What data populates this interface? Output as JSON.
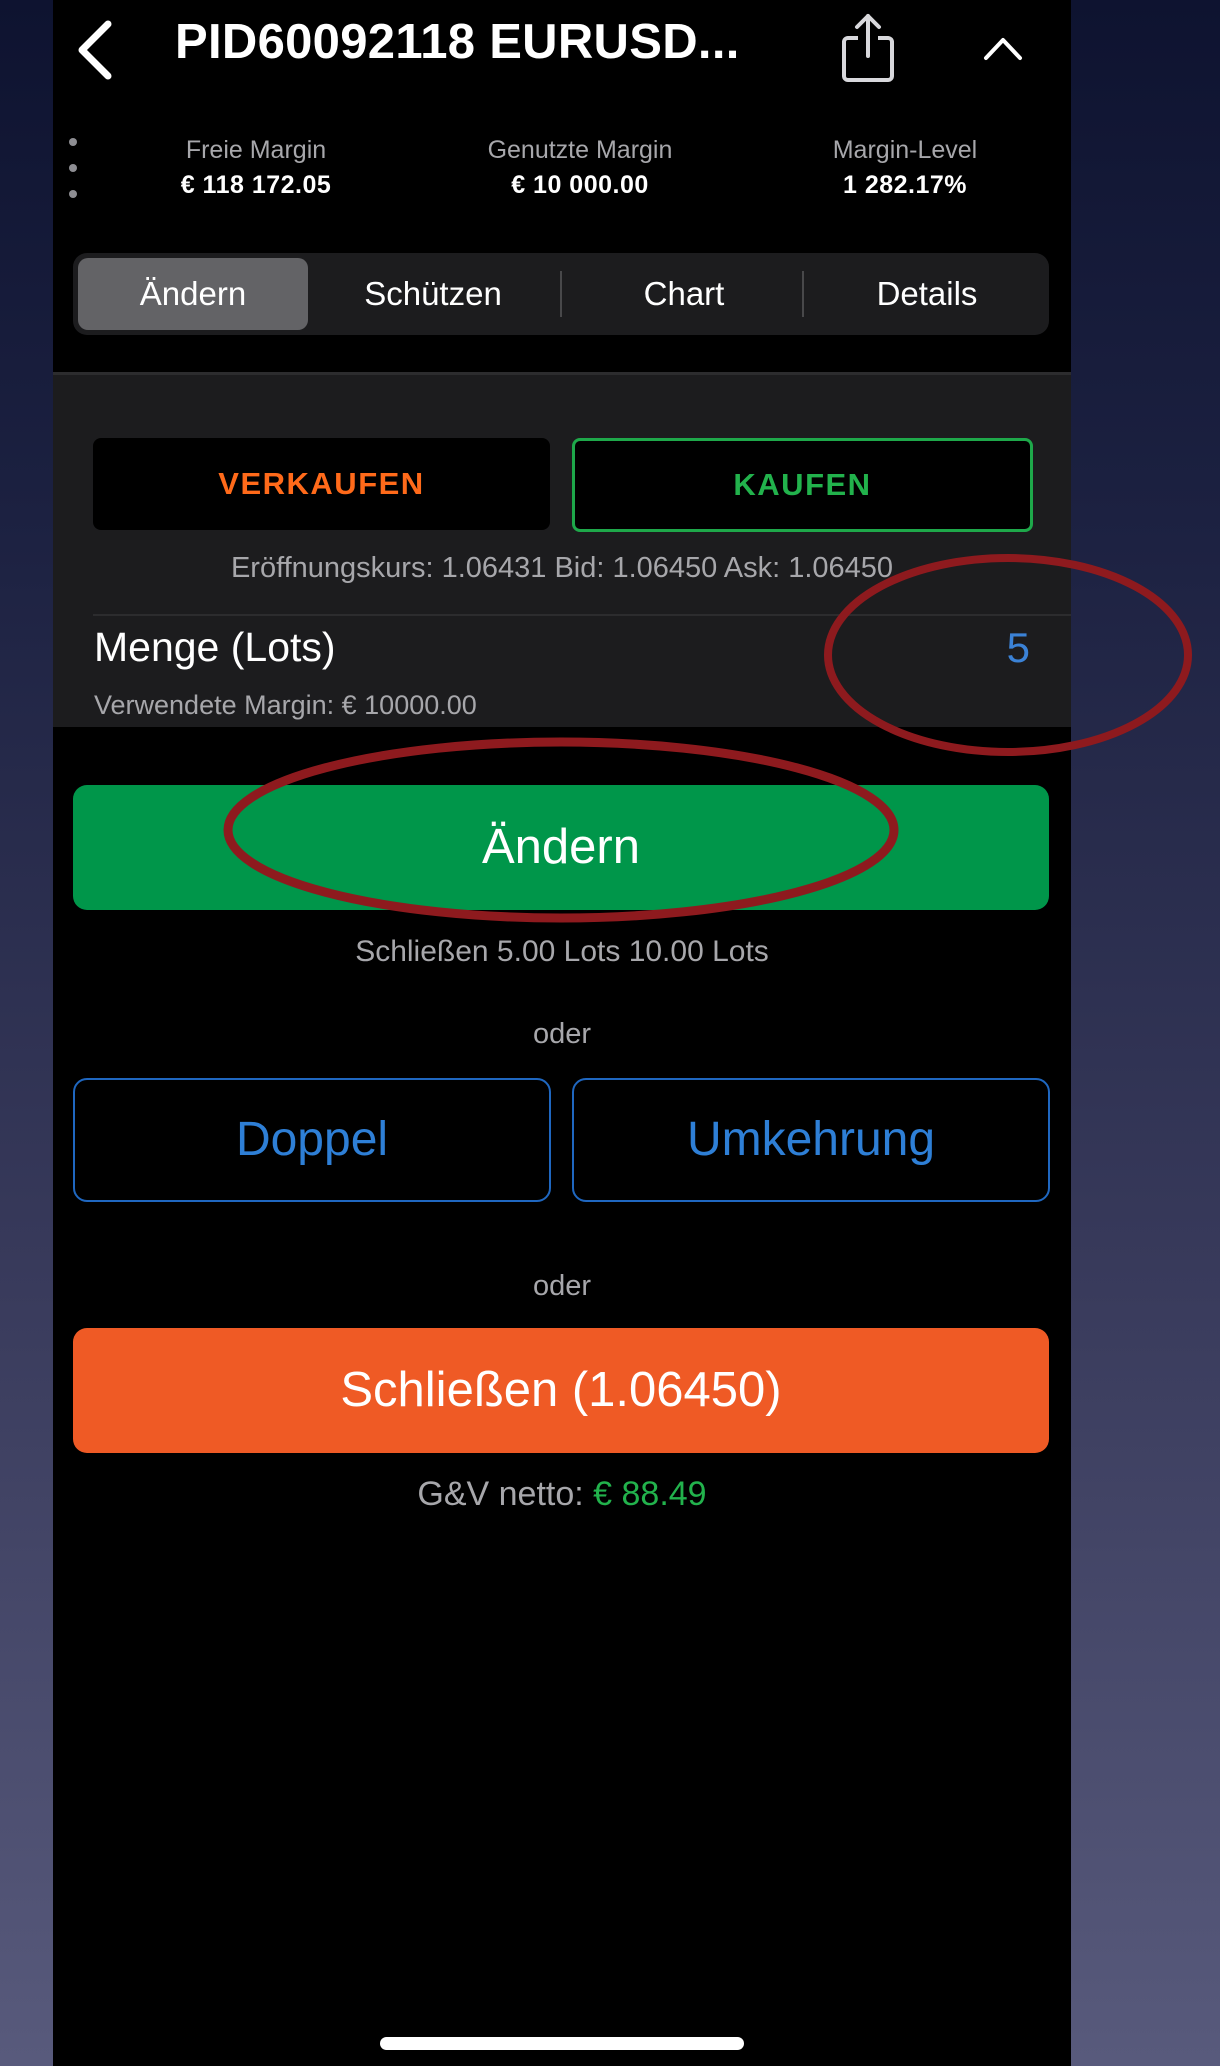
{
  "header": {
    "title": "PID60092118 EURUSD...",
    "back_icon": "chevron-left-icon",
    "share_icon": "share-icon",
    "collapse_icon": "chevron-up-icon",
    "menu_icon": "vertical-dots-icon"
  },
  "account": {
    "free_margin_label": "Freie Margin",
    "free_margin_value": "€ 118 172.05",
    "used_margin_label": "Genutzte Margin",
    "used_margin_value": "€ 10 000.00",
    "margin_level_label": "Margin-Level",
    "margin_level_value": "1 282.17%"
  },
  "tabs": [
    "Ändern",
    "Schützen",
    "Chart",
    "Details"
  ],
  "active_tab": "Ändern",
  "order": {
    "sell_label": "VERKAUFEN",
    "buy_label": "KAUFEN",
    "selected_side": "KAUFEN",
    "prices_text": "Eröffnungskurs: 1.06431   Bid: 1.06450   Ask: 1.06450",
    "quantity_label": "Menge (Lots)",
    "quantity_value": "5",
    "used_margin_text": "Verwendete Margin: € 10000.00"
  },
  "actions": {
    "modify_label": "Ändern",
    "close_info": "Schließen 5.00 Lots 10.00 Lots",
    "or_label": "oder",
    "double_label": "Doppel",
    "reverse_label": "Umkehrung",
    "close_label": "Schließen (1.06450)",
    "pnl_label": "G&V netto:",
    "pnl_value": "€ 88.49"
  },
  "colors": {
    "sell": "#ff6a1a",
    "buy": "#22b24c",
    "modify": "#00964a",
    "close": "#ef5a25",
    "link_blue": "#2e7fd6",
    "annotation": "#8e1a1e"
  }
}
